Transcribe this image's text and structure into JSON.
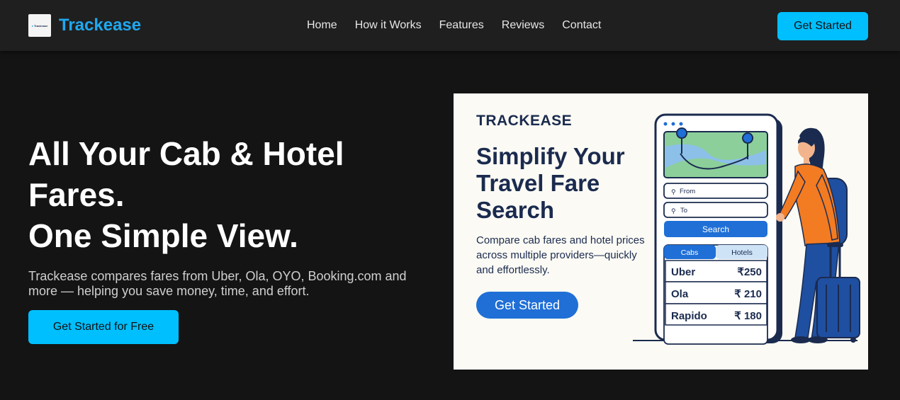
{
  "nav": {
    "logo_mini": "Trackease",
    "brand": "Trackease",
    "links": [
      "Home",
      "How it Works",
      "Features",
      "Reviews",
      "Contact"
    ],
    "cta": "Get Started"
  },
  "hero": {
    "title_line1": "All Your Cab & Hotel",
    "title_line2": "Fares.",
    "title_line3": "One Simple View.",
    "subtitle": "Trackease compares fares from Uber, Ola, OYO, Booking.com and more — helping you save money, time, and effort.",
    "cta": "Get Started for Free"
  },
  "banner": {
    "brand": "TRACKEASE",
    "title": "Simplify Your Travel Fare Search",
    "subtitle": "Compare cab fares and hotel prices across multiple providers—quickly and effortlessly.",
    "cta": "Get Started",
    "phone": {
      "from_label": "From",
      "to_label": "To",
      "search_label": "Search",
      "tab_cabs": "Cabs",
      "tab_hotels": "Hotels",
      "fares": [
        {
          "provider": "Uber",
          "price": "₹250"
        },
        {
          "provider": "Ola",
          "price": "₹ 210"
        },
        {
          "provider": "Rapido",
          "price": "₹ 180"
        }
      ]
    }
  },
  "colors": {
    "accent": "#00bfff",
    "brand_text": "#1fa8f0",
    "navy": "#1b2b4f",
    "banner_button": "#1f6fd6"
  }
}
